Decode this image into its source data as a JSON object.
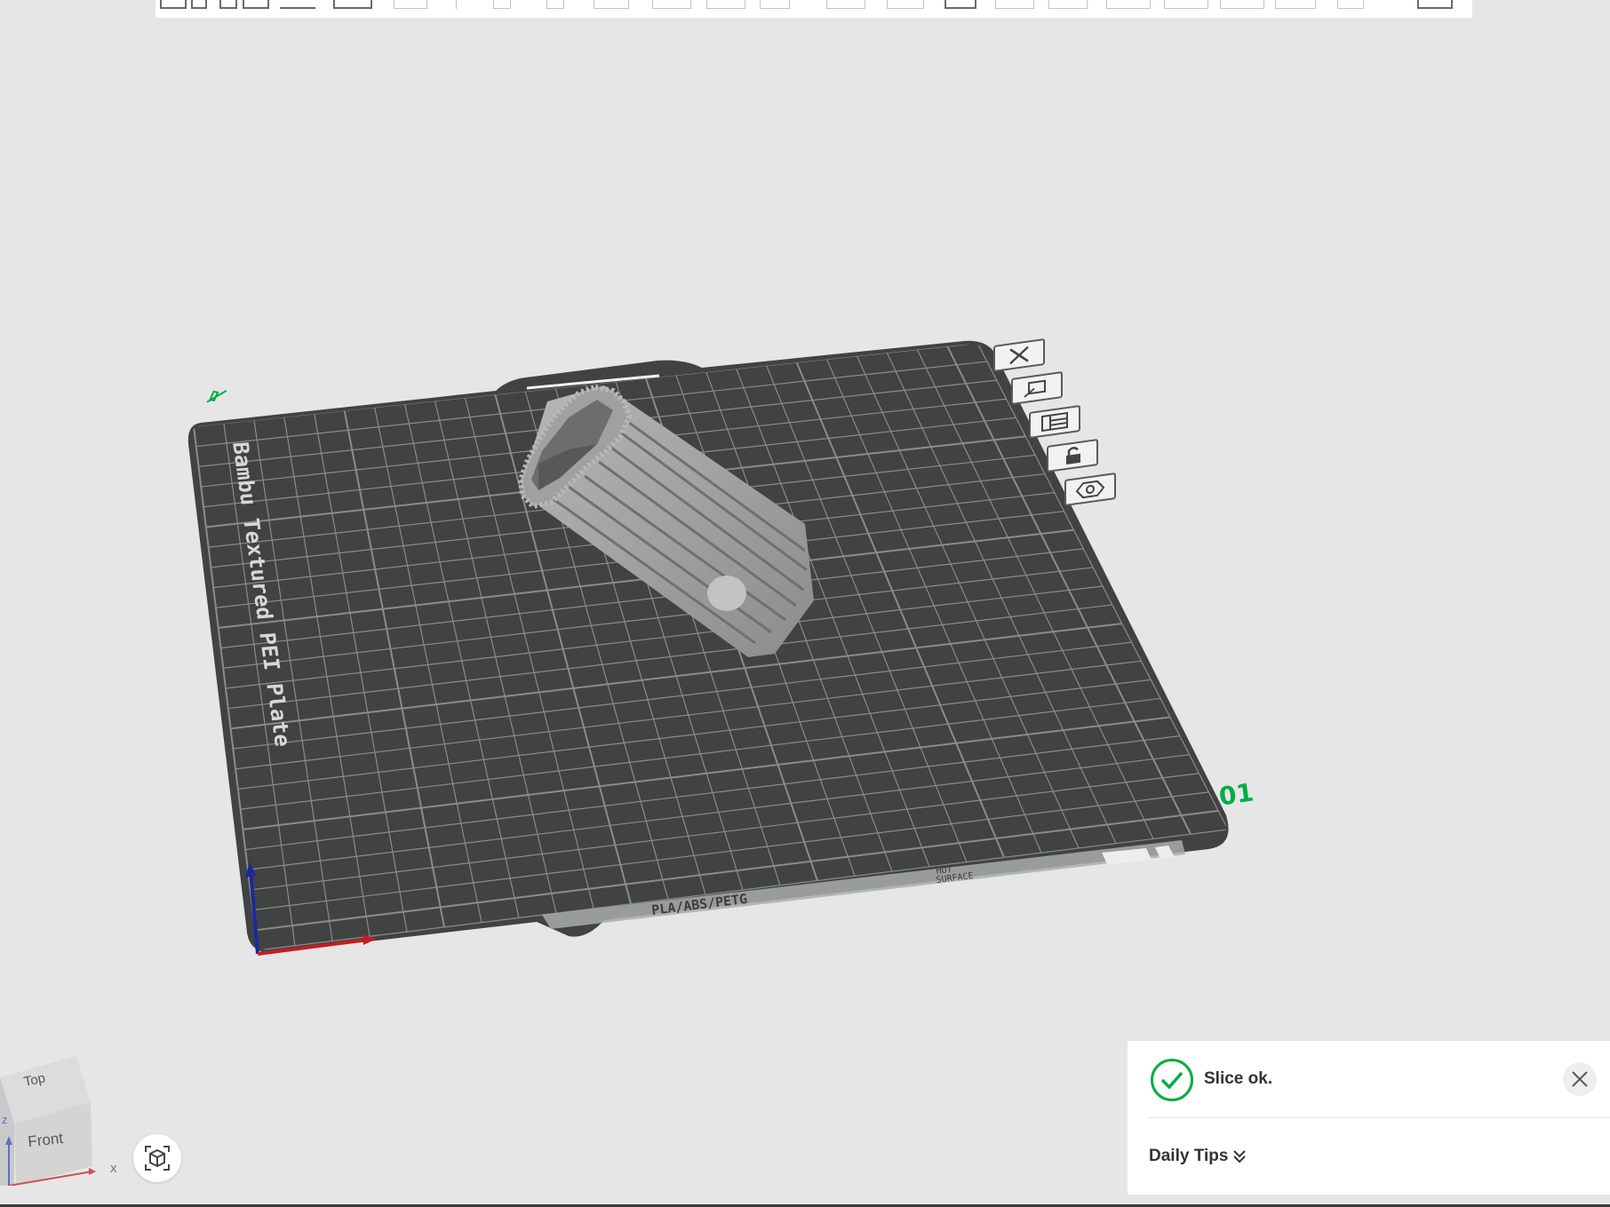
{
  "toolbar": {
    "icons": [
      "add-icon",
      "add-plate-icon",
      "orient-icon",
      "arrange-icon",
      "split-icon",
      "cut-icon",
      "text-icon",
      "support-paint-icon",
      "seam-paint-icon",
      "variable-layer-icon",
      "measure-icon",
      "assembly-icon"
    ]
  },
  "plate": {
    "name": "Bambu Textured PEI Plate",
    "number": "01",
    "material_text": "PLA/ABS/PETG",
    "warning_text_1": "HOT",
    "warning_text_2": "SURFACE",
    "buttons": [
      "close-plate-icon",
      "auto-orient-icon",
      "arrange-plate-icon",
      "lock-plate-icon",
      "plate-settings-icon"
    ]
  },
  "viewcube": {
    "top_label": "Top",
    "front_label": "Front",
    "axis_x": "x",
    "axis_z": "z"
  },
  "notification": {
    "message": "Slice ok.",
    "tips_label": "Daily Tips",
    "status_color": "#00ae42"
  },
  "colors": {
    "background": "#e6e6e6",
    "plate": "#464848",
    "grid": "#8a8c8c",
    "accent": "#00ae42",
    "model": "#9a9c9c"
  }
}
